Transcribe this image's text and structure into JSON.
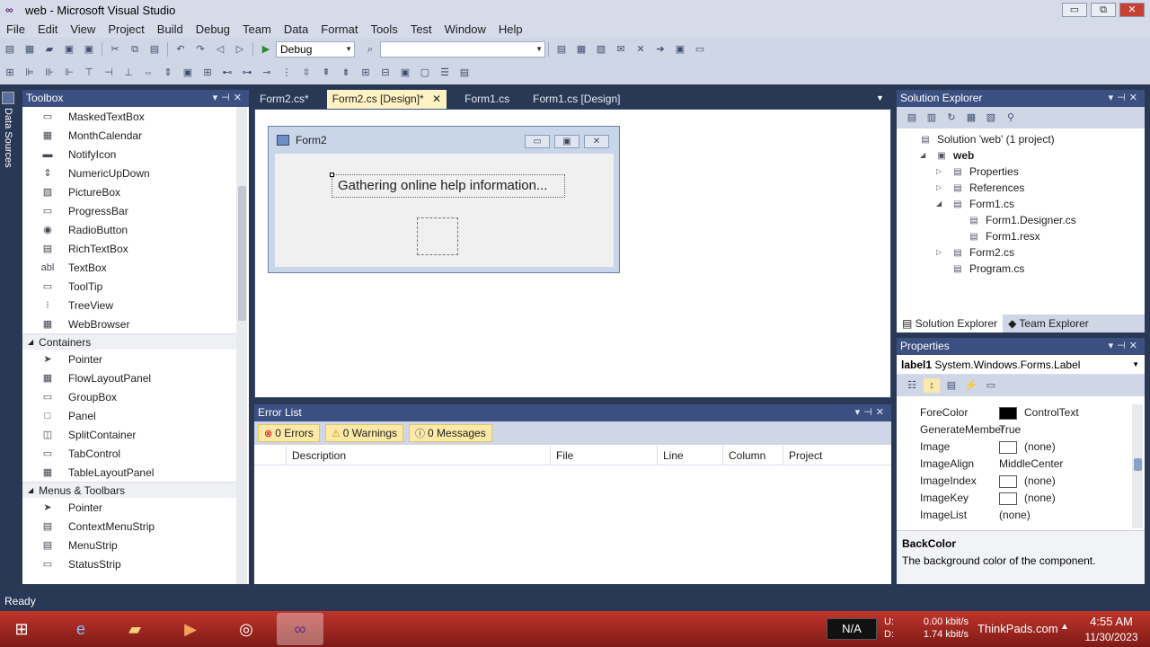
{
  "window": {
    "title": "web - Microsoft Visual Studio",
    "buttons": [
      "▭",
      "⧉",
      "✕"
    ]
  },
  "menu": [
    "File",
    "Edit",
    "View",
    "Project",
    "Build",
    "Debug",
    "Team",
    "Data",
    "Format",
    "Tools",
    "Test",
    "Window",
    "Help"
  ],
  "toolbar": {
    "config": "Debug",
    "platform": ""
  },
  "side_tab": "Data Sources",
  "toolbox": {
    "title": "Toolbox",
    "items": [
      {
        "type": "item",
        "label": "MaskedTextBox",
        "icon": "▭"
      },
      {
        "type": "item",
        "label": "MonthCalendar",
        "icon": "▦"
      },
      {
        "type": "item",
        "label": "NotifyIcon",
        "icon": "▬"
      },
      {
        "type": "item",
        "label": "NumericUpDown",
        "icon": "⇕"
      },
      {
        "type": "item",
        "label": "PictureBox",
        "icon": "▨"
      },
      {
        "type": "item",
        "label": "ProgressBar",
        "icon": "▭"
      },
      {
        "type": "item",
        "label": "RadioButton",
        "icon": "◉"
      },
      {
        "type": "item",
        "label": "RichTextBox",
        "icon": "▤"
      },
      {
        "type": "item",
        "label": "TextBox",
        "icon": "abl"
      },
      {
        "type": "item",
        "label": "ToolTip",
        "icon": "▭"
      },
      {
        "type": "item",
        "label": "TreeView",
        "icon": "⁝"
      },
      {
        "type": "item",
        "label": "WebBrowser",
        "icon": "▦"
      },
      {
        "type": "cat",
        "label": "Containers"
      },
      {
        "type": "item",
        "label": "Pointer",
        "icon": "➤"
      },
      {
        "type": "item",
        "label": "FlowLayoutPanel",
        "icon": "▦"
      },
      {
        "type": "item",
        "label": "GroupBox",
        "icon": "▭"
      },
      {
        "type": "item",
        "label": "Panel",
        "icon": "□"
      },
      {
        "type": "item",
        "label": "SplitContainer",
        "icon": "◫"
      },
      {
        "type": "item",
        "label": "TabControl",
        "icon": "▭"
      },
      {
        "type": "item",
        "label": "TableLayoutPanel",
        "icon": "▦"
      },
      {
        "type": "cat",
        "label": "Menus & Toolbars"
      },
      {
        "type": "item",
        "label": "Pointer",
        "icon": "➤"
      },
      {
        "type": "item",
        "label": "ContextMenuStrip",
        "icon": "▤"
      },
      {
        "type": "item",
        "label": "MenuStrip",
        "icon": "▤"
      },
      {
        "type": "item",
        "label": "StatusStrip",
        "icon": "▭"
      }
    ]
  },
  "doc_tabs": [
    {
      "label": "Form2.cs*",
      "active": false
    },
    {
      "label": "Form2.cs [Design]*",
      "active": true
    },
    {
      "label": "Form1.cs",
      "active": false
    },
    {
      "label": "Form1.cs [Design]",
      "active": false
    }
  ],
  "designer": {
    "form_title": "Form2",
    "label_text": "Gathering online help information..."
  },
  "error_list": {
    "title": "Error List",
    "errors": "0 Errors",
    "warnings": "0 Warnings",
    "messages": "0 Messages",
    "columns": [
      "Description",
      "File",
      "Line",
      "Column",
      "Project"
    ]
  },
  "solution_explorer": {
    "title": "Solution Explorer",
    "tree": [
      {
        "label": "Solution 'web' (1 project)",
        "depth": 0,
        "exp": "",
        "icon": "▤"
      },
      {
        "label": "web",
        "depth": 1,
        "exp": "◢",
        "icon": "▣",
        "bold": true
      },
      {
        "label": "Properties",
        "depth": 2,
        "exp": "▷",
        "icon": "▤"
      },
      {
        "label": "References",
        "depth": 2,
        "exp": "▷",
        "icon": "▤"
      },
      {
        "label": "Form1.cs",
        "depth": 2,
        "exp": "◢",
        "icon": "▤"
      },
      {
        "label": "Form1.Designer.cs",
        "depth": 3,
        "exp": "",
        "icon": "▤"
      },
      {
        "label": "Form1.resx",
        "depth": 3,
        "exp": "",
        "icon": "▤"
      },
      {
        "label": "Form2.cs",
        "depth": 2,
        "exp": "▷",
        "icon": "▤"
      },
      {
        "label": "Program.cs",
        "depth": 2,
        "exp": "",
        "icon": "▤"
      }
    ],
    "tabs": [
      "Solution Explorer",
      "Team Explorer"
    ]
  },
  "properties": {
    "title": "Properties",
    "object_name": "label1",
    "object_type": "System.Windows.Forms.Label",
    "rows": [
      {
        "name": "ForeColor",
        "value": "ControlText",
        "swatch": "#000000"
      },
      {
        "name": "GenerateMember",
        "value": "True"
      },
      {
        "name": "Image",
        "value": "(none)",
        "swatch": "#ffffff"
      },
      {
        "name": "ImageAlign",
        "value": "MiddleCenter"
      },
      {
        "name": "ImageIndex",
        "value": "(none)",
        "swatch": "#ffffff"
      },
      {
        "name": "ImageKey",
        "value": "(none)",
        "swatch": "#ffffff"
      },
      {
        "name": "ImageList",
        "value": "(none)"
      }
    ],
    "desc_title": "BackColor",
    "desc_text": "The background color of the component."
  },
  "status": "Ready",
  "tray": {
    "network": "N/A",
    "upload_label": "U:",
    "upload_rate": "0.00 kbit/s",
    "download_label": "D:",
    "download_rate": "1.74 kbit/s",
    "site": "ThinkPads.com",
    "time": "4:55 AM",
    "date": "11/30/2023"
  }
}
